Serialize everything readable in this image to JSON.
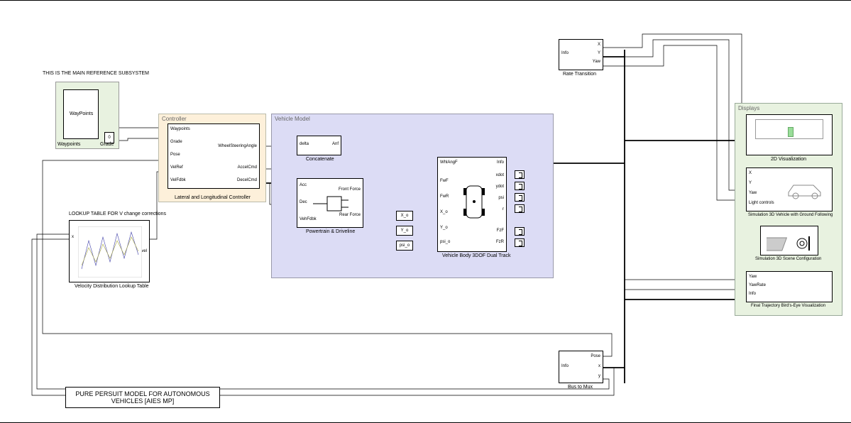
{
  "header_note": "THIS IS THE MAIN REFERENCE SUBSYSTEM",
  "title_box": "PURE PERSUIT MODEL FOR AUTONOMOUS VEHICLES [AIES MP]",
  "areas": {
    "waypoints": {
      "title": "Waypoints",
      "block": "WayPoints",
      "grade": "Grade",
      "grade_val": "0"
    },
    "controller": {
      "title": "Controller",
      "block": "Lateral and Longitudinal Controller",
      "inports": [
        "Waypoints",
        "Grade",
        "Pose",
        "VelRef",
        "VelFdbk"
      ],
      "outports": [
        "WheelSteeringAngle",
        "AccelCmd",
        "DecelCmd"
      ]
    },
    "vehicle": {
      "title": "Vehicle Model",
      "concat": {
        "name": "Concatenate",
        "in": "delta",
        "out": "Anf"
      },
      "powertrain": {
        "name": "Powertrain & Driveline",
        "in": [
          "Acc",
          "Dec",
          "VehFdbk"
        ],
        "out": [
          "Front Force",
          "Rear Force"
        ]
      },
      "ic": [
        "X_o",
        "Y_o",
        "psi_o"
      ],
      "body": {
        "name": "Vehicle Body 3DOF Dual Track",
        "inports": [
          "WhlAngF",
          "FwF",
          "FwR",
          "X_o",
          "Y_o",
          "psi_o"
        ],
        "outports": [
          "Info",
          "xdot",
          "ydot",
          "psi",
          "r",
          "FzF",
          "FzR"
        ]
      }
    },
    "displays": {
      "title": "Displays",
      "viz2d": "2D Visualization",
      "sim3d": {
        "name": "Simulation 3D Vehicle with Ground Following",
        "ports": [
          "X",
          "Y",
          "Yaw",
          "Light controls"
        ]
      },
      "scene": "Simulation 3D Scene Configuration",
      "birdseye": {
        "name": "Final Trajectory Bird's-Eye Visualization",
        "ports": [
          "Yaw",
          "YawRate",
          "Info"
        ]
      }
    }
  },
  "rate_transition": {
    "name": "Rate Transition",
    "in": "Info",
    "out": [
      "X",
      "Y",
      "Yaw"
    ]
  },
  "bus_to_mux": {
    "name": "Bus to Mux",
    "in": "Info",
    "out": [
      "Pose",
      "x",
      "y"
    ]
  },
  "lookup": {
    "note": "LOOKUP TABLE FOR V change corrections",
    "name": "Velocity Distribution Lookup Table",
    "in": "x",
    "out": "vel"
  }
}
